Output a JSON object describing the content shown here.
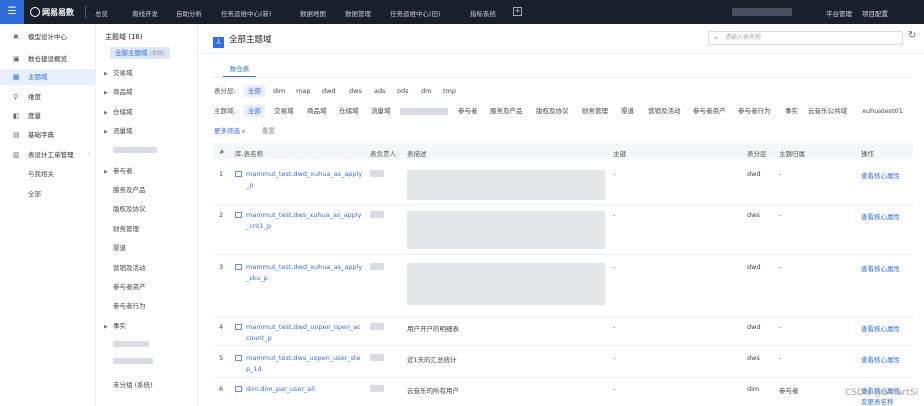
{
  "top": {
    "logo": "网易易数",
    "nav": [
      "总览",
      "离线开发",
      "自助分析",
      "任务运维中心(新)",
      "数据地图",
      "数据管理",
      "任务运维中心(旧)",
      "指标系统"
    ],
    "right": [
      "平台管理",
      "项目配置"
    ]
  },
  "sidebar": {
    "items": [
      {
        "label": "模型设计中心",
        "icon": "model-icon"
      },
      {
        "label": "数仓建设概览",
        "icon": "overview-icon"
      },
      {
        "label": "主题域",
        "icon": "domain-icon"
      },
      {
        "label": "维度",
        "icon": "dimension-icon"
      },
      {
        "label": "度量",
        "icon": "measure-icon"
      },
      {
        "label": "基础字典",
        "icon": "dictionary-icon"
      },
      {
        "label": "表设计工单管理",
        "icon": "ticket-icon"
      },
      {
        "label": "与我相关"
      },
      {
        "label": "全部"
      }
    ]
  },
  "tree": {
    "title": "主题域 (16)",
    "selected": "全部主题域",
    "selected_tag": "(系统)",
    "items": [
      "交易域",
      "商品域",
      "仓储域",
      "流量域",
      "参与者",
      "服务及产品",
      "版权及协议",
      "财务管理",
      "渠道",
      "营销及活动",
      "参与者资产",
      "参与者行为",
      "事实"
    ],
    "last": "未分组 (系统)"
  },
  "main": {
    "title": "全部主题域",
    "search_placeholder": "请输入表名称",
    "tab": "数仓表",
    "layer_label": "表分层:",
    "layers": [
      "全部",
      "dim",
      "map",
      "dwd",
      "dws",
      "ads",
      "ods",
      "dm",
      "tmp"
    ],
    "domain_label": "主题域:",
    "domains": [
      "全部",
      "交易域",
      "商品域",
      "仓储域",
      "流量域",
      "参与者",
      "服务及产品",
      "版权及协议",
      "财务管理",
      "渠道",
      "营销及活动",
      "参与者资产",
      "参与者行为",
      "事实",
      "云音乐公共域",
      "xuhuatest01"
    ],
    "more": "更多筛选",
    "reset": "重置",
    "headers": [
      "#",
      "库.表名称",
      "表负责人",
      "表描述",
      "主键",
      "表分层",
      "主题归属",
      "操作"
    ],
    "rows": [
      {
        "n": "1",
        "name1": "mammut_test.dwd_xuhua_as_apply",
        "name2": "_p",
        "desc": "",
        "pk": "-",
        "layer": "dwd",
        "domain": "-",
        "action": "查看核心属性"
      },
      {
        "n": "2",
        "name1": "mammut_test.dws_xuhua_as_apply",
        "name2": "_cnt1_p",
        "desc": "",
        "pk": "-",
        "layer": "dws",
        "domain": "-",
        "action": "查看核心属性"
      },
      {
        "n": "3",
        "name1": "mammut_test.dwd_xuhua_as_apply",
        "name2": "_sku_p",
        "desc": "",
        "pk": "-",
        "layer": "dwd",
        "domain": "-",
        "action": "查看核心属性"
      },
      {
        "n": "4",
        "name1": "mammut_test.dwd_uopen_open_ac",
        "name2": "count_p",
        "desc": "用户开户的明细表",
        "pk": "-",
        "layer": "dwd",
        "domain": "-",
        "action": "查看核心属性"
      },
      {
        "n": "5",
        "name1": "mammut_test.dws_uopen_user_ste",
        "name2": "p_1d",
        "desc": "近1天的汇总统计",
        "pk": "-",
        "layer": "dws",
        "domain": "-",
        "action": "查看核心属性"
      },
      {
        "n": "6",
        "name1": "dim.dim_par_user_all",
        "name2": "",
        "desc": "云音乐的所有用户",
        "pk": "-",
        "layer": "dim",
        "domain": "参与者",
        "action": "查看核心属性"
      }
    ],
    "row6_action2": "变更表名称"
  },
  "watermark": "CSDN @SmartSi"
}
